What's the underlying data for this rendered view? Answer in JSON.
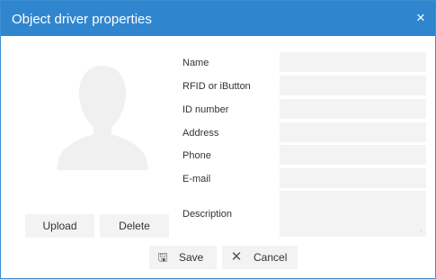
{
  "dialog": {
    "title": "Object driver properties",
    "close_symbol": "×"
  },
  "photo": {
    "icon": "person-silhouette-icon",
    "upload_label": "Upload",
    "delete_label": "Delete"
  },
  "form": {
    "fields": [
      {
        "label": "Name",
        "value": ""
      },
      {
        "label": "RFID or iButton",
        "value": ""
      },
      {
        "label": "ID number",
        "value": ""
      },
      {
        "label": "Address",
        "value": ""
      },
      {
        "label": "Phone",
        "value": ""
      },
      {
        "label": "E-mail",
        "value": ""
      }
    ],
    "description": {
      "label": "Description",
      "value": ""
    }
  },
  "footer": {
    "save_label": "Save",
    "save_icon": "floppy-disk-icon",
    "cancel_label": "Cancel",
    "cancel_icon": "close-x-icon"
  },
  "colors": {
    "titlebar": "#2f86cf",
    "field_bg": "#f3f3f3",
    "avatar": "#f0f0f0"
  }
}
